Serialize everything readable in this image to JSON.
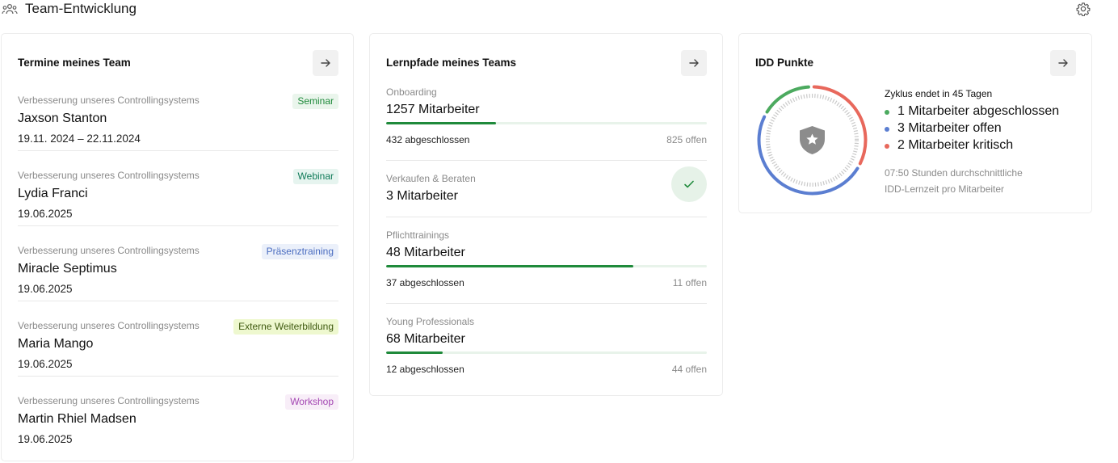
{
  "header": {
    "title": "Team-Entwicklung",
    "icon": "team-icon",
    "settings_icon": "gear-icon"
  },
  "termine": {
    "title": "Termine meines Team",
    "events": [
      {
        "subject": "Verbesserung unseres Controllingsystems",
        "type": "Seminar",
        "name": "Jaxson Stanton",
        "date": "19.11. 2024 – 22.11.2024",
        "badge_bg": "#eaf5ec",
        "badge_color": "#1f8a3b"
      },
      {
        "subject": "Verbesserung unseres Controllingsystems",
        "type": "Webinar",
        "name": "Lydia Franci",
        "date": "19.06.2025",
        "badge_bg": "#e6f4ef",
        "badge_color": "#0f7a58"
      },
      {
        "subject": "Verbesserung unseres Controllingsystems",
        "type": "Präsenztraining",
        "name": "Miracle Septimus",
        "date": "19.06.2025",
        "badge_bg": "#ebf0fa",
        "badge_color": "#4a6cc0"
      },
      {
        "subject": "Verbesserung unseres Controllingsystems",
        "type": "Externe Weiterbildung",
        "name": "Maria Mango",
        "date": "19.06.2025",
        "badge_bg": "#eef8cf",
        "badge_color": "#3f5a10"
      },
      {
        "subject": "Verbesserung unseres Controllingsystems",
        "type": "Workshop",
        "name": "Martin Rhiel Madsen",
        "date": "19.06.2025",
        "badge_bg": "#f8eef8",
        "badge_color": "#a447b3"
      }
    ]
  },
  "lernpfade": {
    "title": "Lernpfade meines Teams",
    "paths": [
      {
        "name": "Onboarding",
        "count": "1257 Mitarbeiter",
        "completed": "432 abgeschlossen",
        "open": "825 offen",
        "progress": 0.343,
        "complete": false
      },
      {
        "name": "Verkaufen & Beraten",
        "count": "3 Mitarbeiter",
        "completed": "",
        "open": "",
        "progress": 1,
        "complete": true
      },
      {
        "name": "Pflichttrainings",
        "count": "48 Mitarbeiter",
        "completed": "37 abgeschlossen",
        "open": "11 offen",
        "progress": 0.77,
        "complete": false
      },
      {
        "name": "Young Professionals",
        "count": "68 Mitarbeiter",
        "completed": "12 abgeschlossen",
        "open": "44 offen",
        "progress": 0.176,
        "complete": false
      }
    ]
  },
  "idd": {
    "title": "IDD Punkte",
    "cycle": "Zyklus endet in 45 Tagen",
    "legend": [
      {
        "text": "1 Mitarbeiter abgeschlossen",
        "color": "#4caa5f",
        "value": 1
      },
      {
        "text": "3 Mitarbeiter offen",
        "color": "#5b7ed1",
        "value": 3
      },
      {
        "text": "2 Mitarbeiter kritisch",
        "color": "#e8685c",
        "value": 2
      }
    ],
    "note_line1": "07:50 Stunden durchschnittliche",
    "note_line2": "IDD-Lernzeit pro Mitarbeiter",
    "center_icon": "shield-star-icon"
  }
}
